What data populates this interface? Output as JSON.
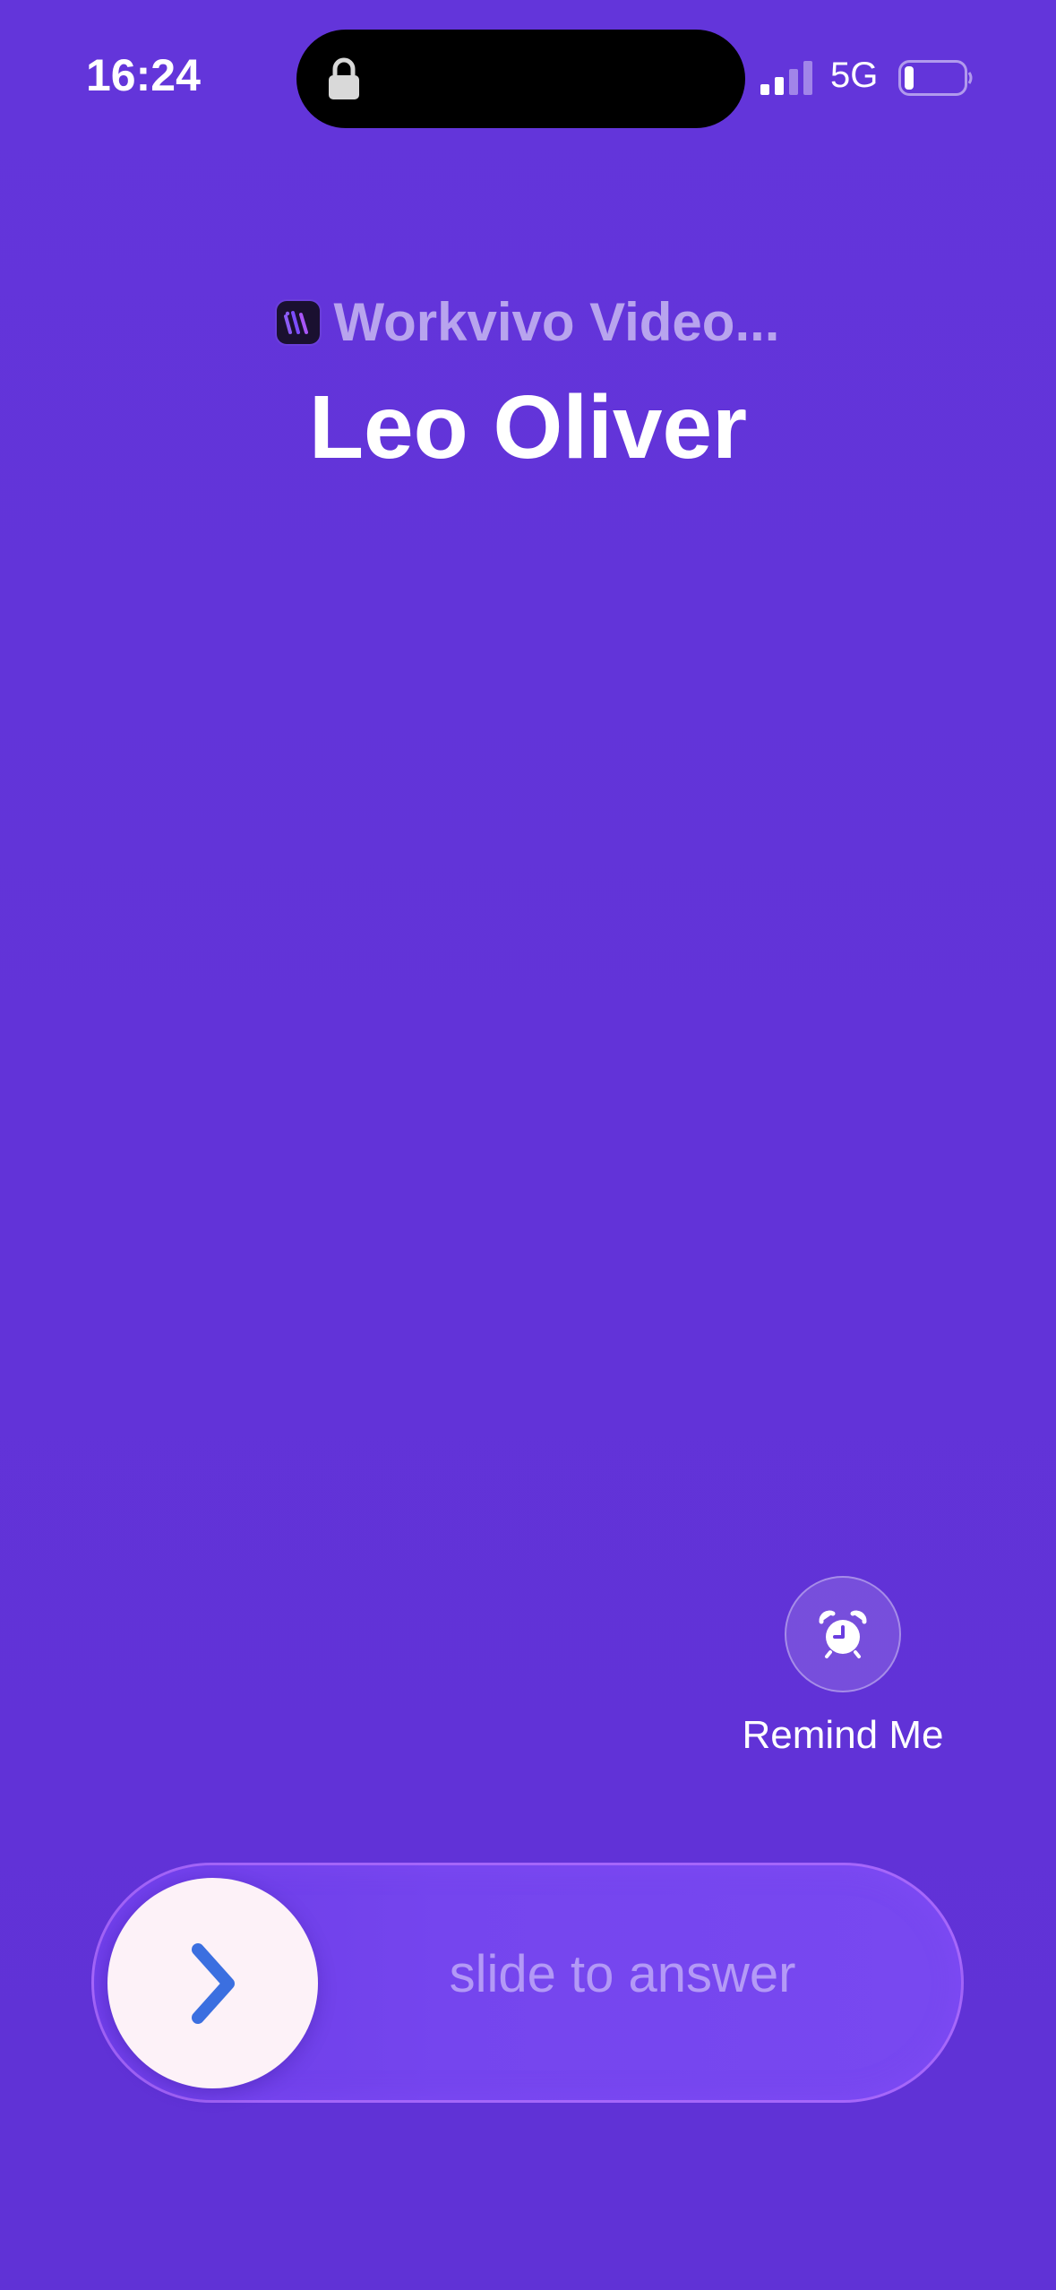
{
  "status_bar": {
    "time": "16:24",
    "network": "5G"
  },
  "call": {
    "app_name": "Workvivo Video...",
    "caller": "Leo Oliver"
  },
  "actions": {
    "remind_label": "Remind Me"
  },
  "slider": {
    "label": "slide to answer"
  },
  "colors": {
    "background": "#6234d8",
    "knob": "#fdf2f8",
    "chevron": "#3b6fe0",
    "track_border": "#be78ff"
  },
  "icons": [
    "lock-icon",
    "signal-icon",
    "battery-icon",
    "app-icon",
    "alarm-clock-icon",
    "chevron-right-icon"
  ]
}
